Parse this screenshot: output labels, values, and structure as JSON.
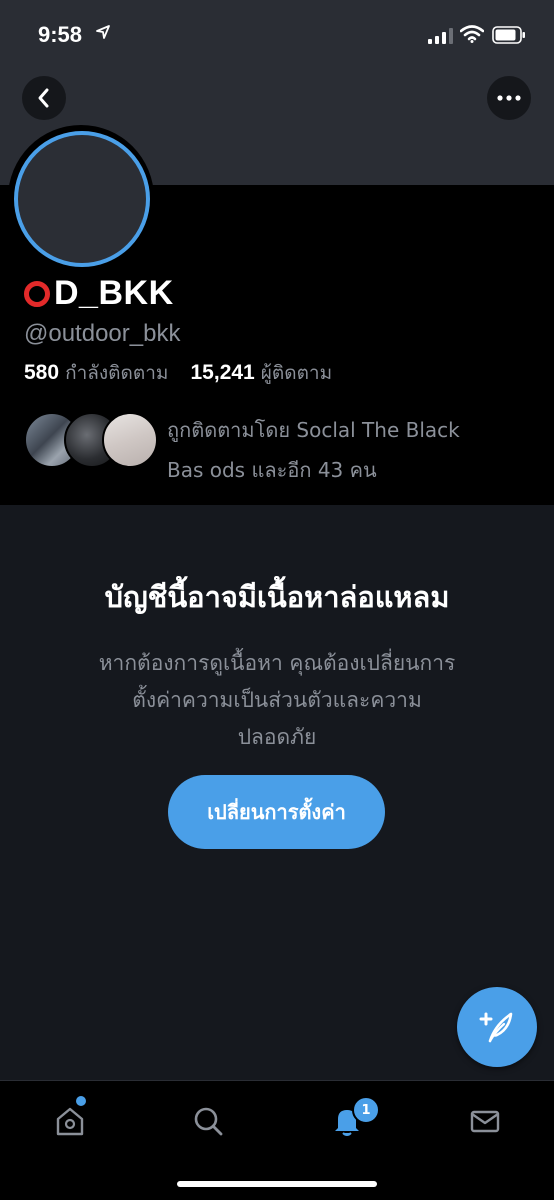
{
  "status_bar": {
    "time": "9:58"
  },
  "profile": {
    "name": "D_BKK",
    "handle": "@outdoor_bkk",
    "following_count": "580",
    "following_label": "กำลังติดตาม",
    "followers_count": "15,241",
    "followers_label": "ผู้ติดตาม",
    "followed_by_line1": "ถูกติดตามโดย Soclal The Black",
    "followed_by_line2": "Bas ods และอีก 43 คน"
  },
  "warning": {
    "title": "บัญชีนี้อาจมีเนื้อหาล่อแหลม",
    "body_line1": "หากต้องการดูเนื้อหา คุณต้องเปลี่ยนการ",
    "body_line2": "ตั้งค่าความเป็นส่วนตัวและความ",
    "body_line3": "ปลอดภัย",
    "button_label": "เปลี่ยนการตั้งค่า"
  },
  "tabbar": {
    "notification_badge": "1"
  },
  "colors": {
    "accent": "#4a9fe8",
    "background": "#15181e",
    "profile_bg": "#000000",
    "muted_text": "#8b9099",
    "name_ring": "#e32a2a"
  },
  "icons": [
    "back-icon",
    "more-icon",
    "home-icon",
    "search-icon",
    "bell-icon",
    "mail-icon",
    "compose-icon",
    "location-icon",
    "signal-icon",
    "wifi-icon",
    "battery-icon"
  ]
}
